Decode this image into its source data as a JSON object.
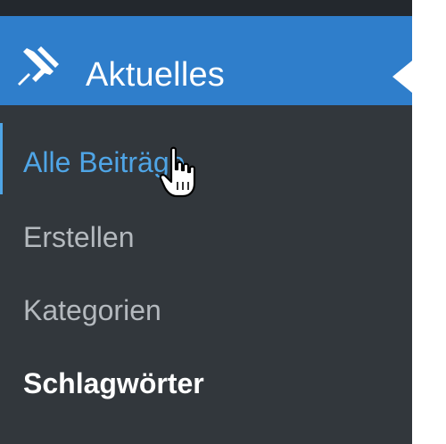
{
  "menu": {
    "current": {
      "label": "Aktuelles",
      "icon": "pushpin-icon"
    },
    "submenu": [
      {
        "label": "Alle Beiträge",
        "state": "hovered"
      },
      {
        "label": "Erstellen",
        "state": "normal"
      },
      {
        "label": "Kategorien",
        "state": "normal"
      },
      {
        "label": "Schlagwörter",
        "state": "bold"
      }
    ]
  },
  "colors": {
    "menu_background": "#32373c",
    "topbar": "#23282d",
    "current_item": "#2f7ecb",
    "submenu_text": "#b4b9be",
    "hover_text": "#4fa5e6",
    "white": "#ffffff"
  },
  "cursor": {
    "icon": "hand-pointer-icon"
  }
}
